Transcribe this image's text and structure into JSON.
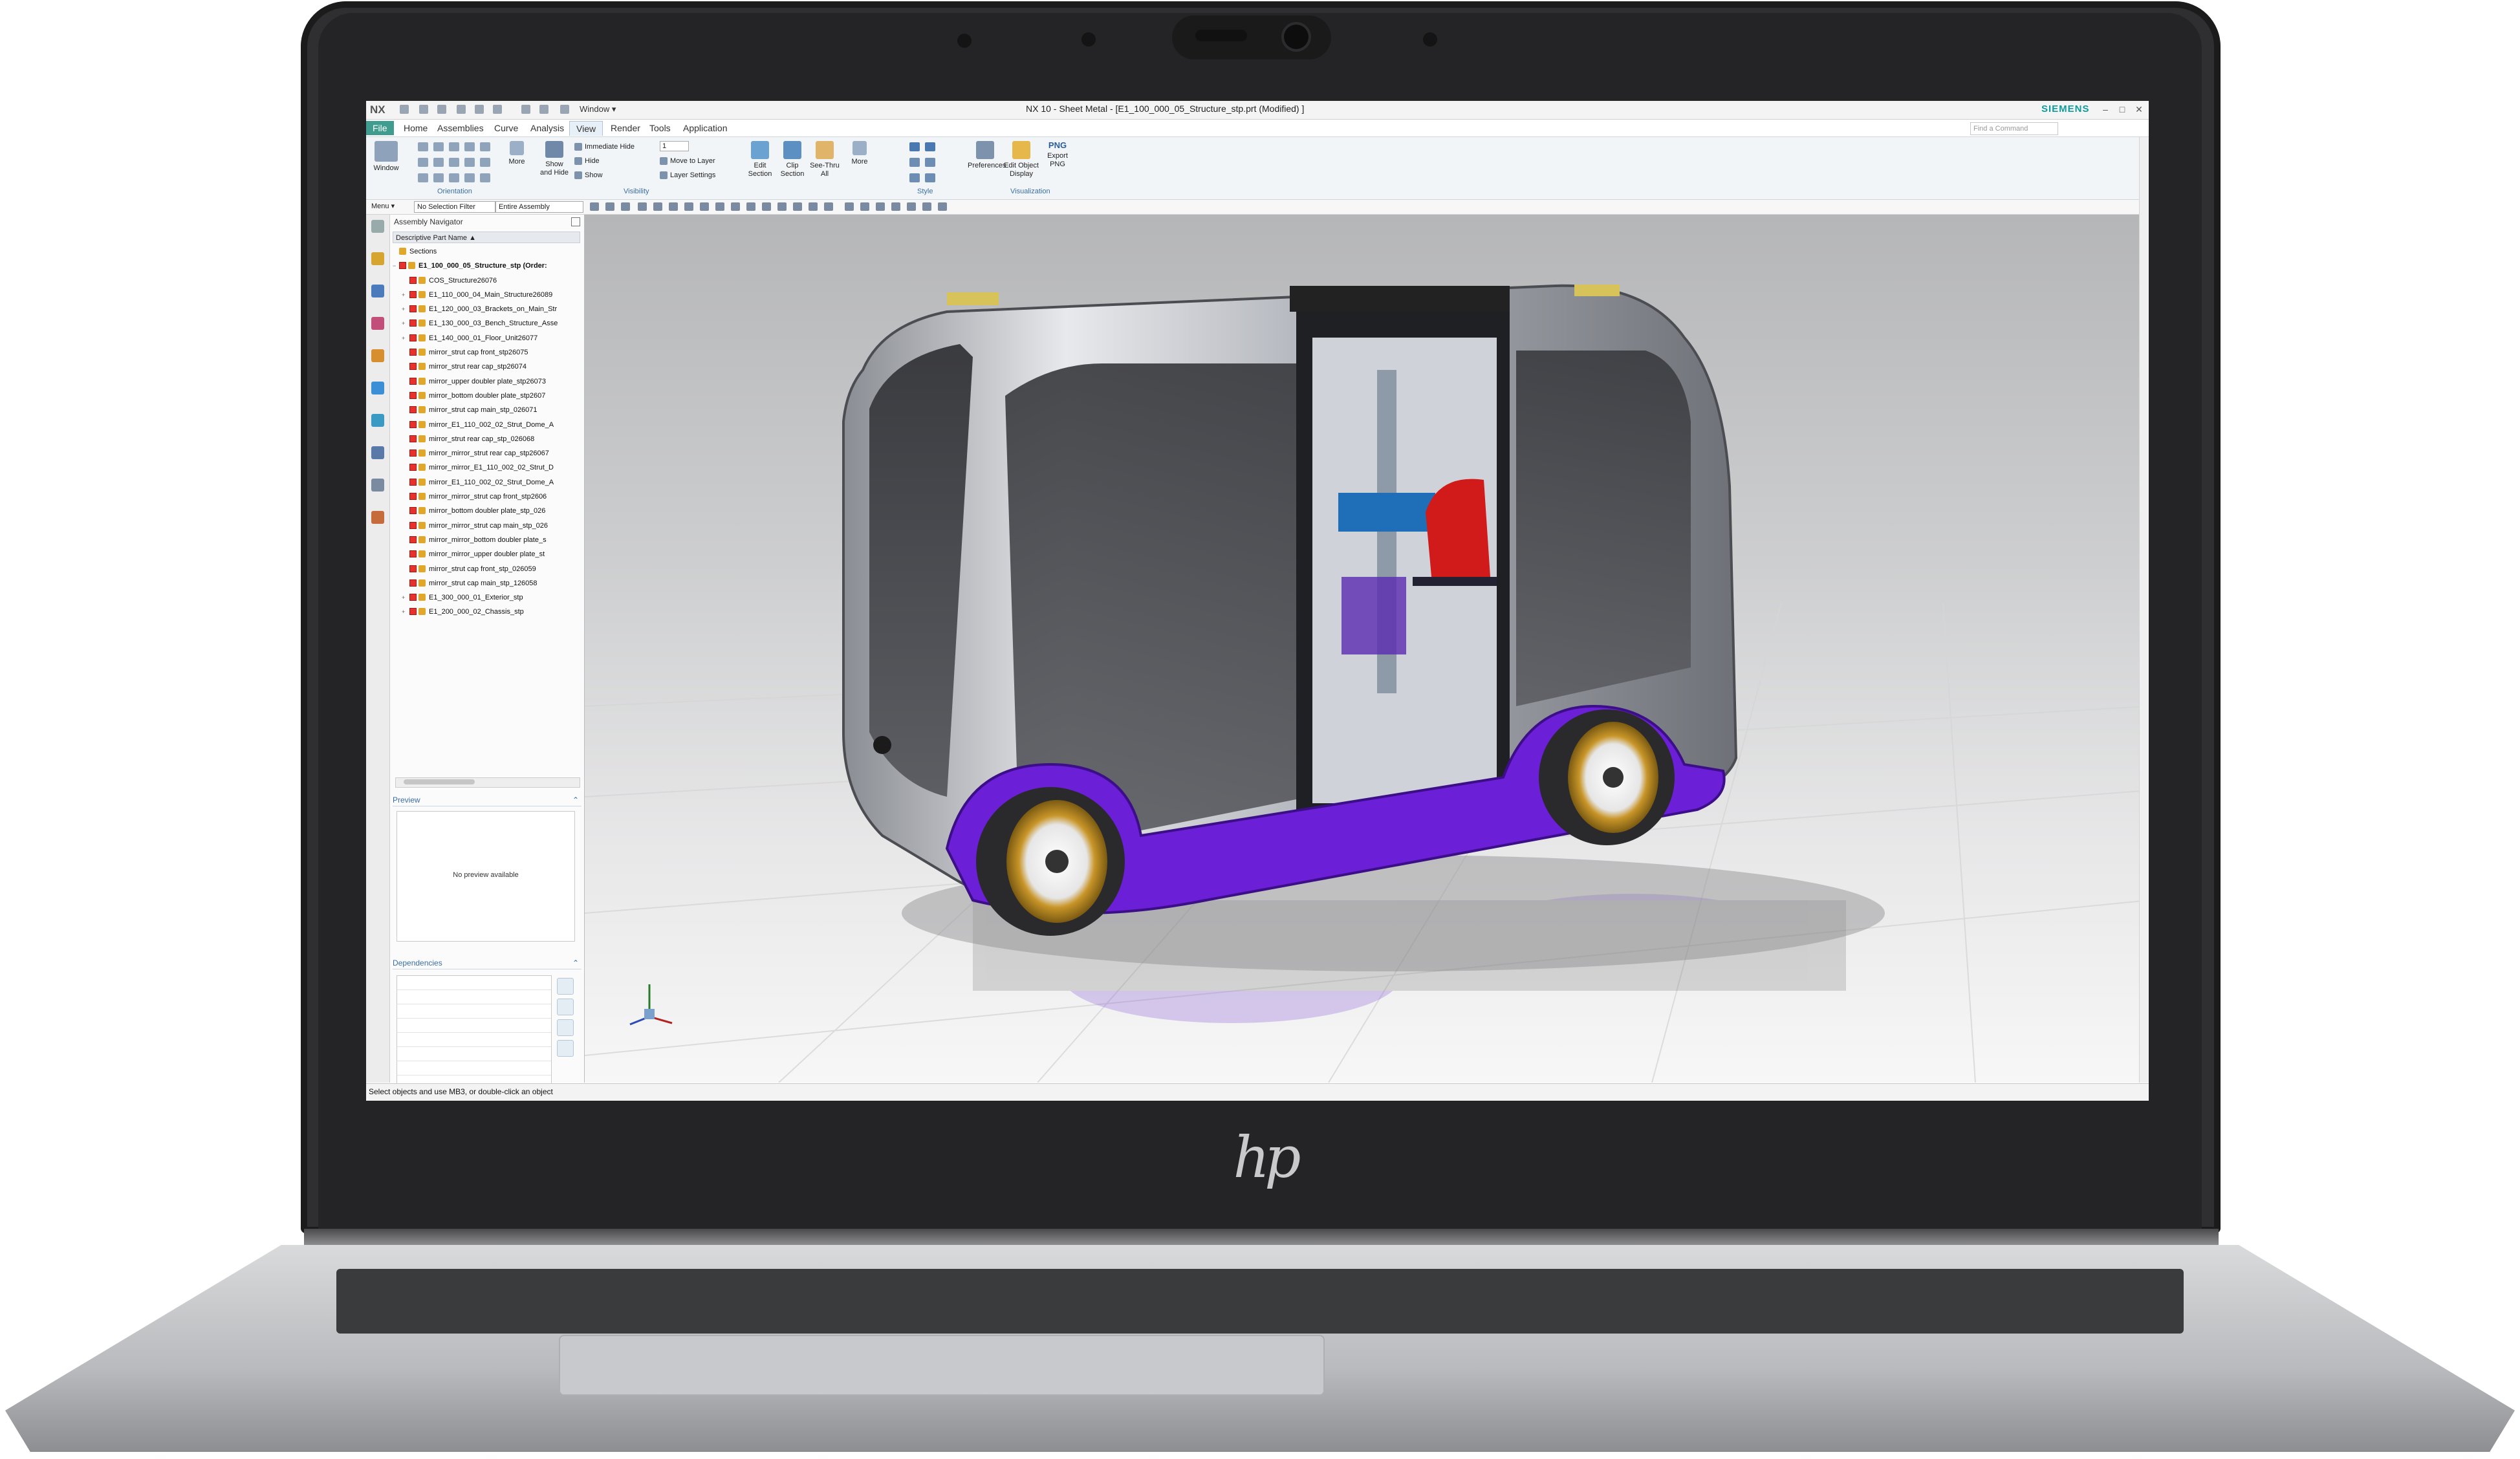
{
  "app": {
    "logo": "NX",
    "window_menu": "Window ▾",
    "title": "NX 10 - Sheet Metal - [E1_100_000_05_Structure_stp.prt (Modified) ]",
    "brand": "SIEMENS",
    "command_search_placeholder": "Find a Command"
  },
  "menu_tabs": [
    "File",
    "Home",
    "Assemblies",
    "Curve",
    "Analysis",
    "View",
    "Render",
    "Tools",
    "Application"
  ],
  "active_tab": "View",
  "ribbon": {
    "window_btn": "Window",
    "orientation_label": "Orientation",
    "more_label": "More",
    "show_hide": "Show\nand Hide",
    "immediate_hide": "Immediate Hide",
    "hide": "Hide",
    "show": "Show",
    "layer_value": "1",
    "move_to_layer": "Move to Layer",
    "layer_settings": "Layer Settings",
    "visibility_label": "Visibility",
    "edit_section": "Edit\nSection",
    "clip_section": "Clip\nSection",
    "see_thru_all": "See-Thru\nAll",
    "more2": "More",
    "style_label": "Style",
    "preferences": "Preferences",
    "edit_object_display": "Edit Object\nDisplay",
    "export_png_top": "PNG",
    "export_png": "Export\nPNG",
    "visualization_label": "Visualization"
  },
  "toolbar": {
    "menu": "Menu ▾",
    "selection_filter": "No Selection Filter",
    "assembly_scope": "Entire Assembly"
  },
  "navigator": {
    "title": "Assembly Navigator",
    "column_header": "Descriptive Part Name",
    "rows": [
      "Sections",
      "E1_100_000_05_Structure_stp (Order:",
      "COS_Structure26076",
      "E1_110_000_04_Main_Structure26089",
      "E1_120_000_03_Brackets_on_Main_Str",
      "E1_130_000_03_Bench_Structure_Asse",
      "E1_140_000_01_Floor_Unit26077",
      "mirror_strut cap front_stp26075",
      "mirror_strut rear cap_stp26074",
      "mirror_upper doubler plate_stp26073",
      "mirror_bottom doubler plate_stp2607",
      "mirror_strut cap main_stp_026071",
      "mirror_E1_110_002_02_Strut_Dome_A",
      "mirror_strut rear cap_stp_026068",
      "mirror_mirror_strut rear cap_stp26067",
      "mirror_mirror_E1_110_002_02_Strut_D",
      "mirror_E1_110_002_02_Strut_Dome_A",
      "mirror_mirror_strut cap front_stp2606",
      "mirror_bottom doubler plate_stp_026",
      "mirror_mirror_strut cap main_stp_026",
      "mirror_mirror_bottom doubler plate_s",
      "mirror_mirror_upper doubler plate_st",
      "mirror_strut cap front_stp_026059",
      "mirror_strut cap main_stp_126058",
      "E1_300_000_01_Exterior_stp",
      "E1_200_000_02_Chassis_stp"
    ],
    "preview_label": "Preview",
    "no_preview": "No preview available",
    "dependencies_label": "Dependencies"
  },
  "status": "Select objects and use MB3, or double-click an object",
  "laptop": {
    "logo": "hp"
  },
  "colors": {
    "accent_file": "#3f9c8e",
    "brand": "#0f9c9c",
    "vehicle_purple": "#6b1fd6",
    "vehicle_silver": "#c9ccd2",
    "seat_red": "#d11a1a",
    "wheel_gold": "#c89528"
  }
}
